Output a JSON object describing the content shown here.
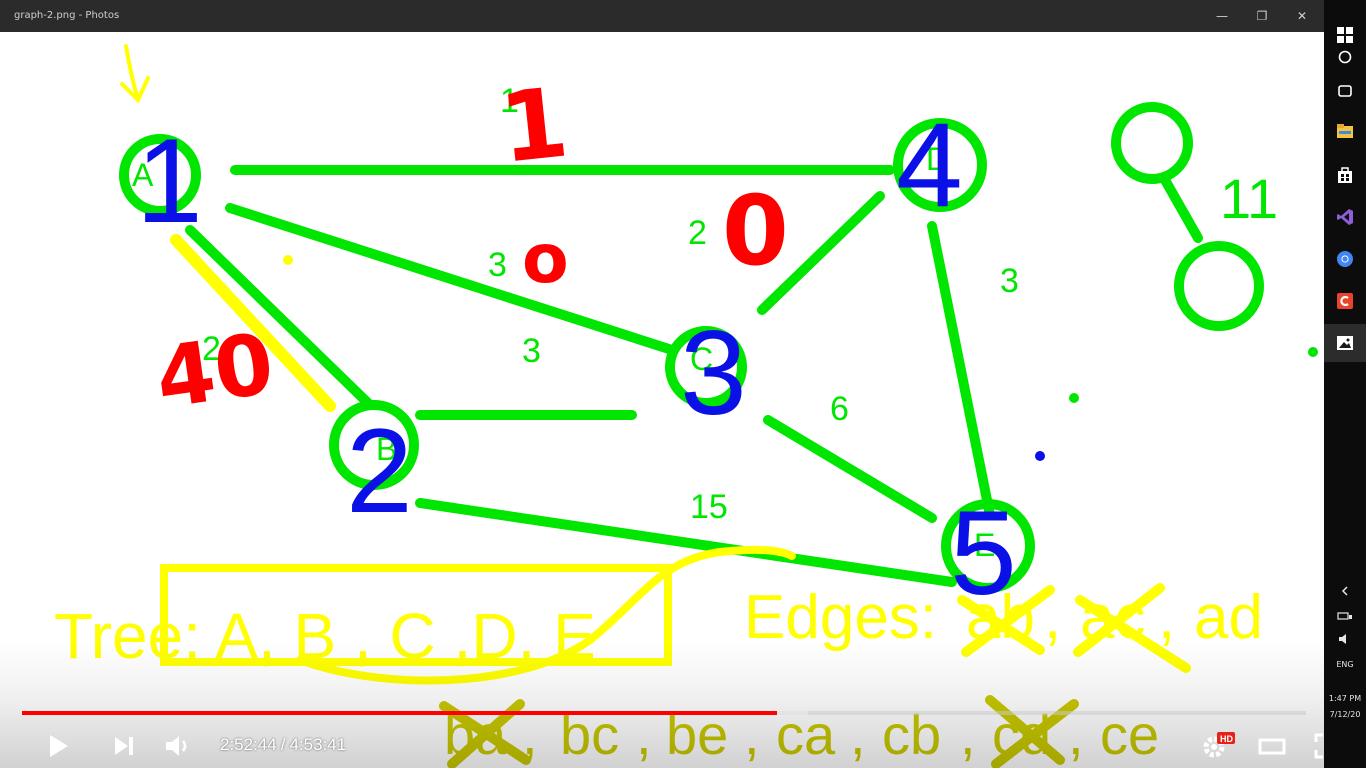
{
  "window": {
    "title": "graph-2.png - Photos",
    "minimize_label": "—",
    "maximize_label": "❐",
    "close_label": "✕"
  },
  "colors": {
    "graph_green": "#00e600",
    "node_blue": "#0a10e6",
    "annotation_red": "#ff0000",
    "highlight_yellow": "#ffff00",
    "progress_red": "#ff0000",
    "taskbar_bg": "#0c0c0c"
  },
  "graph": {
    "node_labels": {
      "A": "A",
      "B": "B",
      "C": "C",
      "D": "D",
      "E": "E"
    },
    "node_numbers": {
      "A": "1",
      "B": "2",
      "C": "3",
      "D": "4",
      "E": "5"
    },
    "edge_weights": {
      "ad": "1",
      "ab": "2",
      "ac": "3",
      "bc": "3",
      "cd": "2",
      "de": "3",
      "ce": "6",
      "be": "15"
    },
    "red_annotations": {
      "ad": "1",
      "cd": "0",
      "ac": "o",
      "ab": "40"
    },
    "side_tree_weight": "11"
  },
  "annotations": {
    "tree_text": "Tree: A, B , C ,D, E",
    "edges_text_prefix": "Edges:",
    "edges_items_row1": [
      {
        "text": "ab",
        "crossed": true
      },
      {
        "text": "ac",
        "crossed": true
      },
      {
        "text": "ad",
        "crossed": false
      }
    ],
    "edges_items_row2": [
      {
        "text": "ba",
        "crossed": true
      },
      {
        "text": "bc",
        "crossed": false
      },
      {
        "text": "be",
        "crossed": false
      },
      {
        "text": "ca",
        "crossed": false
      },
      {
        "text": "cb",
        "crossed": false
      },
      {
        "text": "cd",
        "crossed": true
      },
      {
        "text": "ce",
        "crossed": false
      }
    ]
  },
  "player": {
    "current_time": "2:52:44",
    "separator": "/",
    "duration": "4:53:41",
    "progress_fraction": 0.588,
    "loaded_fraction": 0.612,
    "hd_badge": "HD",
    "play_icon": "play-icon",
    "next_icon": "next-icon",
    "volume_icon": "volume-icon",
    "settings_icon": "gear-icon",
    "theater_icon": "theater-icon",
    "fullscreen_icon": "fullscreen-icon"
  },
  "taskbar": {
    "icons": [
      "windows-logo-icon",
      "search-icon",
      "task-view-icon",
      "file-explorer-icon",
      "store-icon",
      "visual-studio-icon",
      "chrome-icon",
      "app-c-icon",
      "photos-icon"
    ],
    "lang": "ENG",
    "time": "1:47 PM",
    "date": "7/12/20"
  }
}
